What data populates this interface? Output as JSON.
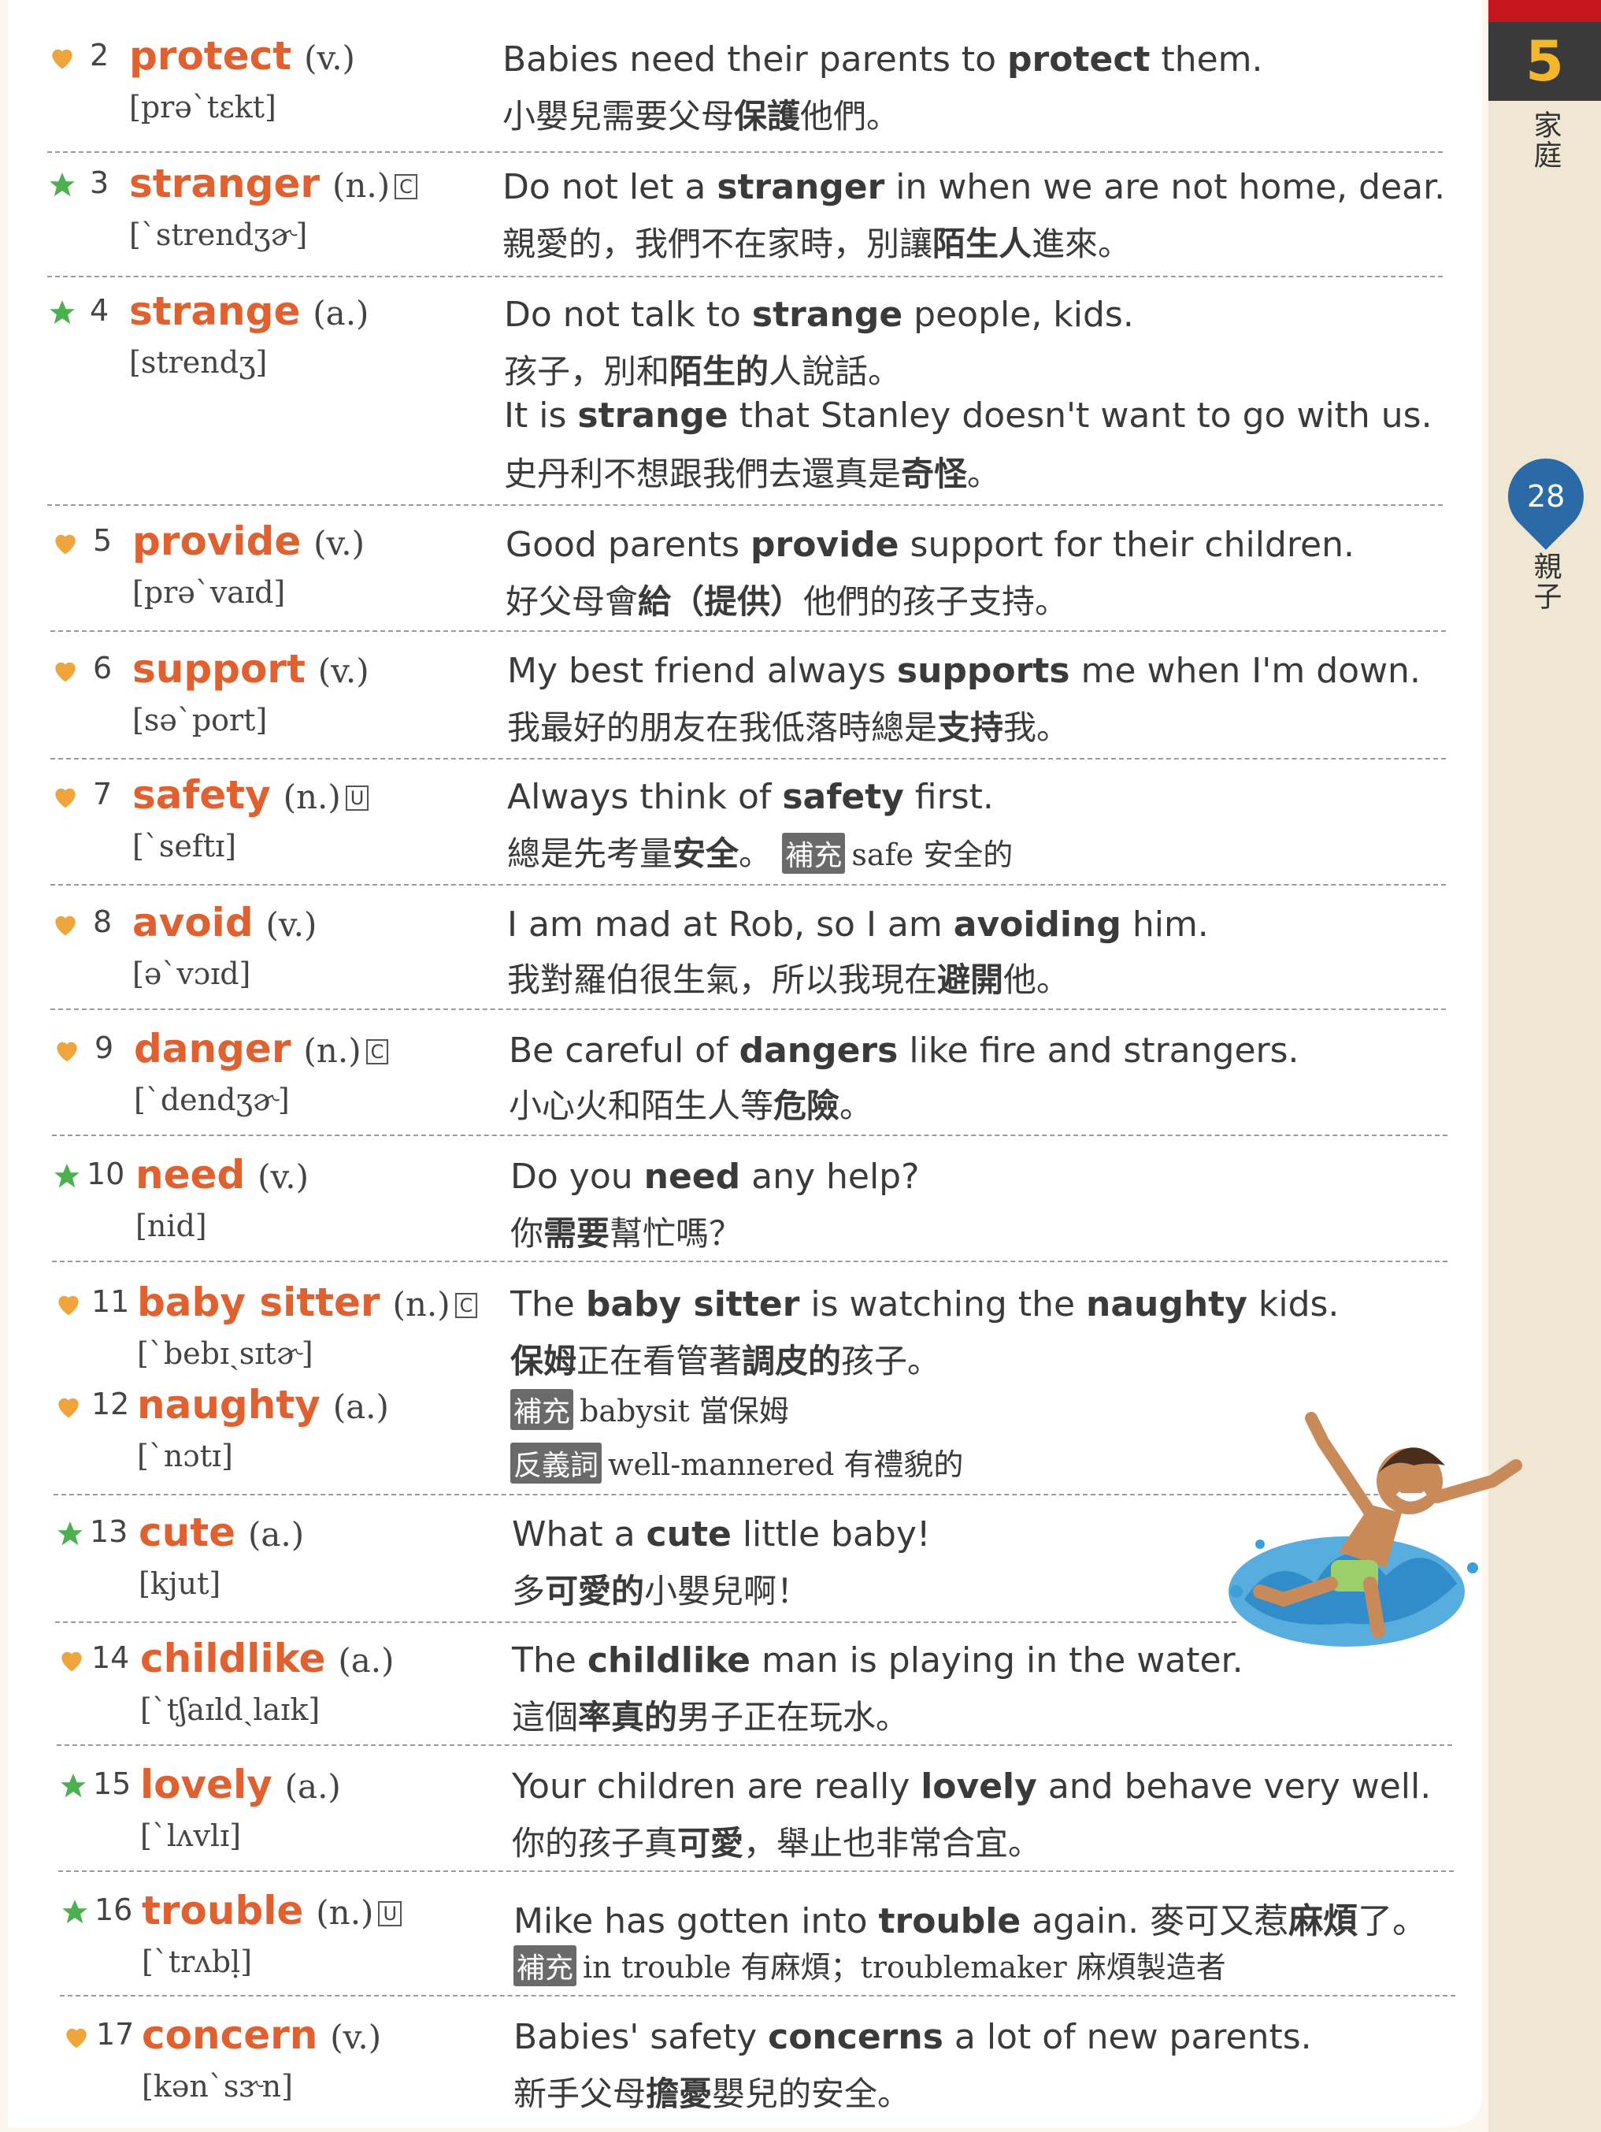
{
  "side_tab": {
    "number": "5",
    "chapter": "家庭",
    "page": "28",
    "section": "親子"
  },
  "colors": {
    "headword": "#e0612f",
    "heart": "#f0a53c",
    "star": "#4caf50",
    "tab_dark": "#3a3a3a",
    "tab_number": "#f3b82a",
    "page_pin": "#2b6aa6"
  },
  "entries": [
    {
      "num": "2",
      "icon": "heart-icon",
      "word": "protect",
      "pos": "(v.)",
      "ipa": "[prəˋtɛkt]",
      "ex_pre": "Babies need their parents to ",
      "ex_bold": "protect",
      "ex_post": " them.",
      "zh_pre": "小嬰兒需要父母",
      "zh_bold": "保護",
      "zh_post": "他們。"
    },
    {
      "num": "3",
      "icon": "star-icon",
      "word": "stranger",
      "pos": "(n.)",
      "box": "C",
      "ipa": "[ˋstrendʒɚ]",
      "ex_pre": "Do not let a ",
      "ex_bold": "stranger",
      "ex_post": " in when we are not home, dear.",
      "zh_pre": "親愛的，我們不在家時，別讓",
      "zh_bold": "陌生人",
      "zh_post": "進來。"
    },
    {
      "num": "4",
      "icon": "star-icon",
      "word": "strange",
      "pos": "(a.)",
      "ipa": "[strendʒ]",
      "ex_pre": "Do not talk to ",
      "ex_bold": "strange",
      "ex_post": " people, kids.",
      "zh_pre": "孩子，別和",
      "zh_bold": "陌生的",
      "zh_post": "人說話。",
      "ex2_pre": "It is ",
      "ex2_bold": "strange",
      "ex2_post": " that Stanley doesn't want to go with us.",
      "zh2_pre": "史丹利不想跟我們去還真是",
      "zh2_bold": "奇怪",
      "zh2_post": "。"
    },
    {
      "num": "5",
      "icon": "heart-icon",
      "word": "provide",
      "pos": "(v.)",
      "ipa": "[prəˋvaɪd]",
      "ex_pre": "Good parents ",
      "ex_bold": "provide",
      "ex_post": " support for their children.",
      "zh_pre": "好父母會",
      "zh_bold": "給（提供）",
      "zh_post": "他們的孩子支持。"
    },
    {
      "num": "6",
      "icon": "heart-icon",
      "word": "support",
      "pos": "(v.)",
      "ipa": "[səˋport]",
      "ex_pre": "My best friend always ",
      "ex_bold": "supports",
      "ex_post": " me when I'm down.",
      "zh_pre": "我最好的朋友在我低落時總是",
      "zh_bold": "支持",
      "zh_post": "我。"
    },
    {
      "num": "7",
      "icon": "heart-icon",
      "word": "safety",
      "pos": "(n.)",
      "box": "U",
      "ipa": "[ˋseftɪ]",
      "ex_pre": "Always think of ",
      "ex_bold": "safety",
      "ex_post": " first.",
      "zh_pre": "總是先考量",
      "zh_bold": "安全",
      "zh_post": "。",
      "note_tag": "補充",
      "note_text": "safe 安全的"
    },
    {
      "num": "8",
      "icon": "heart-icon",
      "word": "avoid",
      "pos": "(v.)",
      "ipa": "[əˋvɔɪd]",
      "ex_pre": "I am mad at Rob, so I am ",
      "ex_bold": "avoiding",
      "ex_post": " him.",
      "zh_pre": "我對羅伯很生氣，所以我現在",
      "zh_bold": "避開",
      "zh_post": "他。"
    },
    {
      "num": "9",
      "icon": "heart-icon",
      "word": "danger",
      "pos": "(n.)",
      "box": "C",
      "ipa": "[ˋdendʒɚ]",
      "ex_pre": "Be careful of ",
      "ex_bold": "dangers",
      "ex_post": " like fire and strangers.",
      "zh_pre": "小心火和陌生人等",
      "zh_bold": "危險",
      "zh_post": "。"
    },
    {
      "num": "10",
      "icon": "star-icon",
      "word": "need",
      "pos": "(v.)",
      "ipa": "[nid]",
      "ex_pre": "Do you ",
      "ex_bold": "need",
      "ex_post": " any help?",
      "zh_pre": "你",
      "zh_bold": "需要",
      "zh_post": "幫忙嗎？"
    },
    {
      "num": "11",
      "icon": "heart-icon",
      "word": "baby sitter",
      "pos": "(n.)",
      "box": "C",
      "ipa": "[ˋbebɪˏsɪtɚ]",
      "ex_pre": "The ",
      "ex_bold": "baby sitter",
      "ex_post": " is watching the ",
      "ex_bold2": "naughty",
      "ex_post2": " kids.",
      "zh_pre": "",
      "zh_bold": "保姆",
      "zh_post": "正在看管著",
      "zh_bold2": "調皮的",
      "zh_post2": "孩子。",
      "note_tag": "補充",
      "note_text": "babysit 當保姆"
    },
    {
      "num": "12",
      "icon": "heart-icon",
      "word": "naughty",
      "pos": "(a.)",
      "ipa": "[ˋnɔtɪ]",
      "note_tag": "反義詞",
      "note_text": "well-mannered 有禮貌的"
    },
    {
      "num": "13",
      "icon": "star-icon",
      "word": "cute",
      "pos": "(a.)",
      "ipa": "[kjut]",
      "ex_pre": "What a ",
      "ex_bold": "cute",
      "ex_post": " little baby!",
      "zh_pre": "多",
      "zh_bold": "可愛的",
      "zh_post": "小嬰兒啊！"
    },
    {
      "num": "14",
      "icon": "heart-icon",
      "word": "childlike",
      "pos": "(a.)",
      "ipa": "[ˋtʃaɪldˏlaɪk]",
      "ex_pre": "The ",
      "ex_bold": "childlike",
      "ex_post": " man is playing in the water.",
      "zh_pre": "這個",
      "zh_bold": "率真的",
      "zh_post": "男子正在玩水。"
    },
    {
      "num": "15",
      "icon": "star-icon",
      "word": "lovely",
      "pos": "(a.)",
      "ipa": "[ˋlʌvlɪ]",
      "ex_pre": "Your children are really ",
      "ex_bold": "lovely",
      "ex_post": " and behave very well.",
      "zh_pre": "你的孩子真",
      "zh_bold": "可愛",
      "zh_post": "，舉止也非常合宜。"
    },
    {
      "num": "16",
      "icon": "star-icon",
      "word": "trouble",
      "pos": "(n.)",
      "box": "U",
      "ipa": "[ˋtrʌbḷ]",
      "ex_pre": "Mike has gotten into ",
      "ex_bold": "trouble",
      "ex_post": " again. 麥可又惹",
      "ex_bold2": "麻煩",
      "ex_post2": "了。",
      "note_tag": "補充",
      "note_text": "in trouble 有麻煩；troublemaker 麻煩製造者"
    },
    {
      "num": "17",
      "icon": "heart-icon",
      "word": "concern",
      "pos": "(v.)",
      "ipa": "[kənˋsɝn]",
      "ex_pre": "Babies' safety ",
      "ex_bold": "concerns",
      "ex_post": " a lot of new parents.",
      "zh_pre": "新手父母",
      "zh_bold": "擔憂",
      "zh_post": "嬰兒的安全。"
    }
  ]
}
